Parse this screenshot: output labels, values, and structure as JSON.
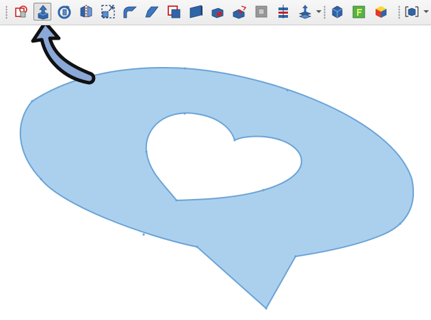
{
  "toolbar": {
    "tools": [
      {
        "name": "sketch-tool",
        "icon": "sketch-icon"
      },
      {
        "name": "extrude-tool",
        "icon": "extrude-icon",
        "active": true
      },
      {
        "name": "revolve-tool",
        "icon": "revolve-icon"
      },
      {
        "name": "mirror-tool",
        "icon": "mirror-icon"
      },
      {
        "name": "scale-tool",
        "icon": "scale-icon"
      },
      {
        "name": "fillet-tool",
        "icon": "fillet-icon"
      },
      {
        "name": "chamfer-tool",
        "icon": "chamfer-icon"
      },
      {
        "name": "offset-tool",
        "icon": "offset-icon"
      },
      {
        "name": "thickness-tool",
        "icon": "thickness-icon"
      },
      {
        "name": "draft-tool",
        "icon": "draft-icon"
      },
      {
        "name": "cut-tool",
        "icon": "cut-icon"
      },
      {
        "name": "hollow-tool",
        "icon": "hollow-icon"
      },
      {
        "name": "section-tool",
        "icon": "section-icon"
      },
      {
        "name": "project-tool",
        "icon": "project-icon"
      },
      {
        "name": "solid-tool",
        "icon": "solid-icon"
      },
      {
        "name": "face-tool",
        "icon": "face-icon"
      },
      {
        "name": "color-cube-tool",
        "icon": "color-cube-icon"
      },
      {
        "name": "view-tool",
        "icon": "view-icon"
      }
    ]
  },
  "canvas": {
    "shape_fill": "#abd0ee",
    "shape_stroke": "#6aa3d6",
    "arrow_fill": "#8aa8d8",
    "arrow_stroke": "#111111"
  }
}
